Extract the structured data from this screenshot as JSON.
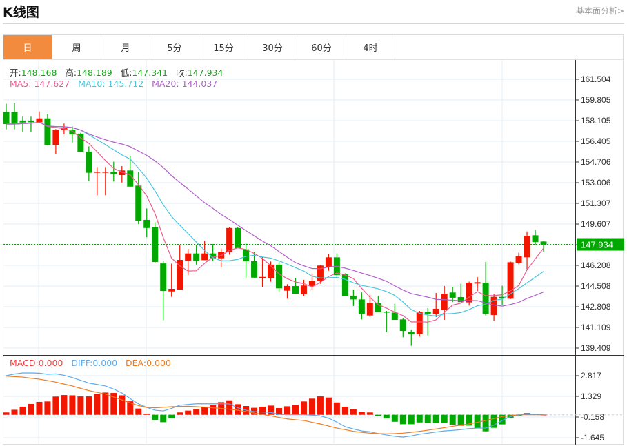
{
  "header": {
    "title": "K线图",
    "link": "基本面分析>"
  },
  "tabs": [
    {
      "label": "日",
      "active": true
    },
    {
      "label": "周"
    },
    {
      "label": "月"
    },
    {
      "label": "5分"
    },
    {
      "label": "15分"
    },
    {
      "label": "30分"
    },
    {
      "label": "60分"
    },
    {
      "label": "4时"
    }
  ],
  "ohlc_legend": {
    "open_label": "开:",
    "open": "148.168",
    "high_label": "高:",
    "high": "148.189",
    "low_label": "低:",
    "low": "147.341",
    "close_label": "收:",
    "close": "147.934"
  },
  "ma_legend": {
    "ma5": "MA5: 147.627",
    "ma10": "MA10: 145.712",
    "ma20": "MA20: 144.037"
  },
  "macd_legend": {
    "macd": "MACD:0.000",
    "diff": "DIFF:0.000",
    "dea": "DEA:0.000"
  },
  "current_price": "147.934",
  "colors": {
    "up": "#f21600",
    "down": "#00a800",
    "ma5": "#ef5b8e",
    "ma10": "#45c6de",
    "ma20": "#b35fcb",
    "diff": "#5aabf0",
    "dea": "#f27a1e",
    "accent": "#f38b3f"
  },
  "chart_data": {
    "type": "candlestick",
    "price_axis": {
      "ticks": [
        "161.504",
        "159.805",
        "158.105",
        "156.405",
        "154.706",
        "153.006",
        "151.307",
        "149.607",
        "147.908",
        "146.208",
        "144.508",
        "142.808",
        "141.109",
        "139.409"
      ],
      "range": [
        139.409,
        161.504
      ]
    },
    "macd_axis": {
      "ticks": [
        "2.817",
        "1.329",
        "-0.158",
        "-1.645"
      ],
      "range": [
        -1.645,
        2.817
      ]
    },
    "candles_ohlc": [
      [
        158.82,
        159.48,
        157.39,
        157.82
      ],
      [
        158.82,
        159.55,
        157.39,
        157.82
      ],
      [
        158.11,
        158.43,
        157.16,
        157.95
      ],
      [
        158.11,
        158.43,
        157.16,
        157.97
      ],
      [
        157.97,
        158.86,
        157.95,
        158.29
      ],
      [
        158.29,
        158.62,
        156.07,
        156.1
      ],
      [
        156.12,
        157.41,
        155.37,
        157.35
      ],
      [
        157.33,
        157.86,
        156.97,
        157.5
      ],
      [
        157.37,
        157.63,
        156.31,
        156.97
      ],
      [
        157.03,
        157.1,
        155.54,
        155.54
      ],
      [
        155.56,
        155.99,
        153.14,
        153.82
      ],
      [
        153.82,
        154.29,
        151.97,
        153.91
      ],
      [
        153.82,
        154.29,
        151.97,
        153.91
      ],
      [
        153.91,
        154.72,
        153.1,
        153.72
      ],
      [
        153.63,
        154.37,
        153.02,
        154.01
      ],
      [
        154.01,
        155.21,
        152.65,
        152.68
      ],
      [
        152.76,
        153.89,
        149.6,
        149.89
      ],
      [
        149.95,
        150.89,
        148.51,
        149.28
      ],
      [
        149.36,
        149.75,
        146.45,
        146.49
      ],
      [
        146.37,
        146.54,
        141.71,
        144.11
      ],
      [
        144.07,
        146.35,
        143.62,
        144.28
      ],
      [
        144.22,
        147.87,
        144.22,
        146.66
      ],
      [
        146.58,
        147.56,
        145.43,
        147.19
      ],
      [
        147.19,
        147.85,
        146.28,
        146.58
      ],
      [
        146.64,
        148.25,
        146.64,
        147.19
      ],
      [
        147.19,
        147.96,
        146.58,
        146.81
      ],
      [
        146.79,
        147.59,
        146.07,
        147.32
      ],
      [
        147.28,
        149.38,
        147.09,
        149.28
      ],
      [
        149.28,
        149.32,
        147.62,
        147.62
      ],
      [
        147.53,
        148.05,
        145.2,
        146.55
      ],
      [
        146.55,
        147.34,
        145.2,
        145.2
      ],
      [
        145.2,
        146.9,
        144.45,
        145.26
      ],
      [
        145.13,
        146.53,
        144.87,
        146.27
      ],
      [
        146.27,
        146.49,
        144.07,
        144.32
      ],
      [
        144.13,
        144.66,
        143.47,
        144.51
      ],
      [
        144.51,
        145.17,
        143.88,
        143.88
      ],
      [
        143.85,
        145.02,
        143.66,
        144.55
      ],
      [
        144.51,
        145.55,
        144.22,
        144.94
      ],
      [
        144.92,
        146.26,
        144.7,
        146.19
      ],
      [
        146.06,
        147.15,
        145.77,
        146.87
      ],
      [
        146.87,
        147.21,
        145.13,
        145.41
      ],
      [
        145.47,
        145.55,
        143.7,
        143.7
      ],
      [
        143.72,
        144.22,
        142.87,
        143.41
      ],
      [
        143.41,
        143.98,
        141.77,
        142.24
      ],
      [
        142.09,
        143.79,
        141.96,
        143.15
      ],
      [
        143.15,
        143.72,
        142.37,
        142.37
      ],
      [
        142.41,
        142.47,
        140.71,
        142.33
      ],
      [
        142.33,
        143.05,
        141.73,
        141.73
      ],
      [
        141.77,
        141.9,
        140.3,
        140.82
      ],
      [
        140.77,
        140.92,
        139.6,
        140.56
      ],
      [
        140.56,
        142.47,
        140.35,
        142.41
      ],
      [
        142.39,
        142.71,
        140.45,
        142.24
      ],
      [
        142.19,
        143.94,
        141.96,
        142.64
      ],
      [
        142.53,
        144.51,
        141.73,
        143.88
      ],
      [
        143.98,
        144.45,
        143.19,
        143.55
      ],
      [
        143.6,
        144.7,
        143.19,
        143.19
      ],
      [
        143.17,
        144.87,
        142.9,
        144.79
      ],
      [
        144.72,
        145.25,
        144.11,
        144.83
      ],
      [
        144.79,
        146.49,
        142.09,
        142.21
      ],
      [
        142.13,
        143.88,
        141.66,
        143.62
      ],
      [
        143.62,
        144.53,
        142.98,
        143.51
      ],
      [
        143.47,
        146.53,
        143.43,
        146.47
      ],
      [
        146.38,
        147.25,
        146.3,
        146.96
      ],
      [
        146.87,
        149.0,
        145.89,
        148.64
      ],
      [
        148.68,
        149.13,
        147.89,
        148.13
      ],
      [
        148.168,
        148.189,
        147.341,
        147.934
      ]
    ],
    "macd_hist": [
      0.17,
      0.36,
      0.58,
      0.78,
      0.93,
      0.96,
      1.31,
      1.42,
      1.4,
      1.32,
      1.32,
      1.49,
      1.6,
      1.57,
      1.4,
      0.97,
      0.45,
      0.08,
      -0.36,
      -0.53,
      -0.25,
      0.17,
      0.3,
      0.38,
      0.58,
      0.69,
      0.91,
      1.04,
      0.76,
      0.63,
      0.5,
      0.58,
      0.66,
      0.48,
      0.61,
      0.71,
      0.96,
      1.16,
      1.32,
      1.24,
      0.89,
      0.58,
      0.41,
      0.21,
      0.17,
      -0.08,
      -0.26,
      -0.5,
      -0.68,
      -0.68,
      -0.55,
      -0.61,
      -0.59,
      -0.56,
      -0.71,
      -0.79,
      -0.78,
      -0.96,
      -1.19,
      -0.94,
      -0.69,
      -0.23,
      -0.07,
      0.12,
      0.05,
      0.01
    ],
    "diff": [
      2.81,
      2.93,
      3.01,
      3.01,
      2.99,
      2.91,
      2.94,
      2.84,
      2.68,
      2.48,
      2.28,
      2.18,
      2.07,
      1.85,
      1.57,
      1.16,
      0.79,
      0.53,
      0.33,
      0.28,
      0.46,
      0.69,
      0.74,
      0.79,
      0.79,
      0.79,
      0.79,
      0.78,
      0.5,
      0.33,
      0.23,
      0.2,
      0.17,
      0.03,
      0.0,
      0.0,
      0.0,
      -0.03,
      -0.08,
      -0.25,
      -0.53,
      -0.86,
      -1.02,
      -1.16,
      -1.22,
      -1.35,
      -1.45,
      -1.55,
      -1.6,
      -1.52,
      -1.4,
      -1.32,
      -1.24,
      -1.16,
      -1.12,
      -1.07,
      -0.99,
      -0.96,
      -0.96,
      -0.74,
      -0.41,
      -0.13,
      -0.03,
      0.05,
      0.03,
      0.0
    ],
    "dea": [
      2.78,
      2.74,
      2.71,
      2.63,
      2.56,
      2.46,
      2.35,
      2.21,
      2.07,
      1.9,
      1.74,
      1.61,
      1.49,
      1.28,
      1.07,
      0.86,
      0.66,
      0.53,
      0.5,
      0.54,
      0.58,
      0.6,
      0.61,
      0.58,
      0.55,
      0.5,
      0.46,
      0.4,
      0.33,
      0.23,
      0.13,
      0.03,
      -0.08,
      -0.19,
      -0.3,
      -0.36,
      -0.41,
      -0.54,
      -0.66,
      -0.81,
      -0.96,
      -1.07,
      -1.19,
      -1.26,
      -1.32,
      -1.35,
      -1.37,
      -1.35,
      -1.32,
      -1.26,
      -1.19,
      -1.11,
      -1.02,
      -0.93,
      -0.83,
      -0.74,
      -0.66,
      -0.54,
      -0.41,
      -0.28,
      -0.13,
      -0.07,
      0.0,
      0.0,
      0.0,
      0.0
    ]
  }
}
